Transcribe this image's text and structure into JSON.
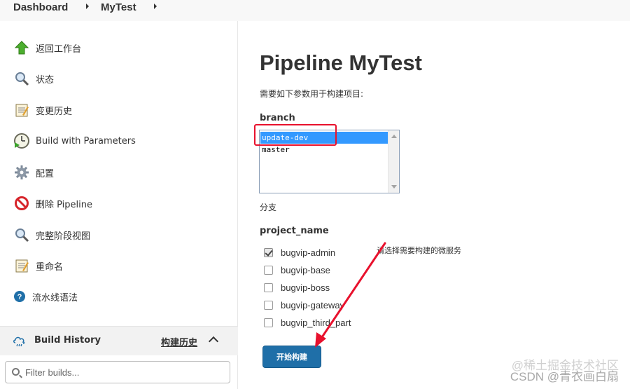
{
  "breadcrumb": {
    "items": [
      "Dashboard",
      "MyTest"
    ]
  },
  "sidebar": {
    "tasks": [
      {
        "label": "返回工作台",
        "icon": "up-arrow-icon"
      },
      {
        "label": "状态",
        "icon": "magnifier-icon"
      },
      {
        "label": "变更历史",
        "icon": "notepad-icon"
      },
      {
        "label": "Build with Parameters",
        "icon": "clock-play-icon"
      },
      {
        "label": "配置",
        "icon": "gear-icon"
      },
      {
        "label": "删除 Pipeline",
        "icon": "no-entry-icon"
      },
      {
        "label": "完整阶段视图",
        "icon": "magnifier-icon"
      },
      {
        "label": "重命名",
        "icon": "notepad-icon"
      },
      {
        "label": "流水线语法",
        "icon": "help-icon"
      }
    ],
    "build_history": {
      "title": "Build History",
      "link": "构建历史"
    },
    "filter": {
      "placeholder": "Filter builds..."
    }
  },
  "main": {
    "title": "Pipeline MyTest",
    "intro": "需要如下参数用于构建项目:",
    "branch": {
      "name": "branch",
      "options": [
        "update-dev",
        "master"
      ],
      "selected": "update-dev",
      "description": "分支"
    },
    "project_name": {
      "name": "project_name",
      "choices": [
        {
          "label": "bugvip-admin",
          "checked": true
        },
        {
          "label": "bugvip-base",
          "checked": false
        },
        {
          "label": "bugvip-boss",
          "checked": false
        },
        {
          "label": "bugvip-gateway",
          "checked": false
        },
        {
          "label": "bugvip_third_part",
          "checked": false
        }
      ],
      "description": "请选择需要构建的微服务"
    },
    "build_button": "开始构建"
  },
  "watermark": {
    "line1": "@稀土掘金技术社区",
    "line2": "CSDN @青衣画白扇"
  },
  "colors": {
    "accent": "#1f6fa8",
    "selection": "#3399ff",
    "annotation": "#e8112d"
  }
}
